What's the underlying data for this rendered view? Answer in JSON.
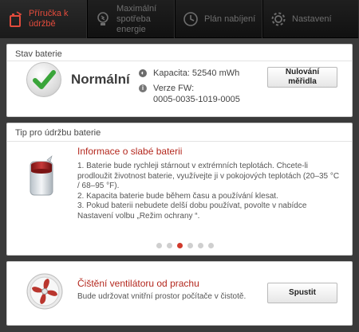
{
  "tabs": [
    {
      "label": "Příručka k údržbě",
      "active": true,
      "icon": "battery-tip-icon"
    },
    {
      "label": "Maximální spotřeba energie",
      "active": false,
      "icon": "lightbulb-icon"
    },
    {
      "label": "Plán nabíjení",
      "active": false,
      "icon": "clock-icon"
    },
    {
      "label": "Nastavení",
      "active": false,
      "icon": "gear-icon"
    }
  ],
  "battery_status": {
    "title": "Stav baterie",
    "status": "Normální",
    "capacity": "Kapacita: 52540 mWh",
    "fw_label": "Verze FW:",
    "fw_value": "0005-0035-1019-0005",
    "reset_button": "Nulování\nměřidla"
  },
  "tip": {
    "title": "Tip pro údržbu baterie",
    "heading": "Informace o slabé baterii",
    "body": "1. Baterie bude rychleji stárnout v extrémních teplotách. Chcete-li prodloužit životnost baterie, využívejte ji v pokojových teplotách (20–35 °C / 68–95 °F).\n2. Kapacita baterie bude během času a používání klesat.\n3. Pokud baterii nebudete delší dobu používat, povolte v nabídce Nastavení volbu „Režim ochrany “.",
    "page_count": 6,
    "active_page": 3
  },
  "fan": {
    "heading": "Čištění ventilátoru od prachu",
    "description": "Bude udržovat vnitřní prostor počítače v čistotě.",
    "button": "Spustit"
  },
  "colors": {
    "accent": "#d13a2c",
    "check": "#3aa53a"
  }
}
